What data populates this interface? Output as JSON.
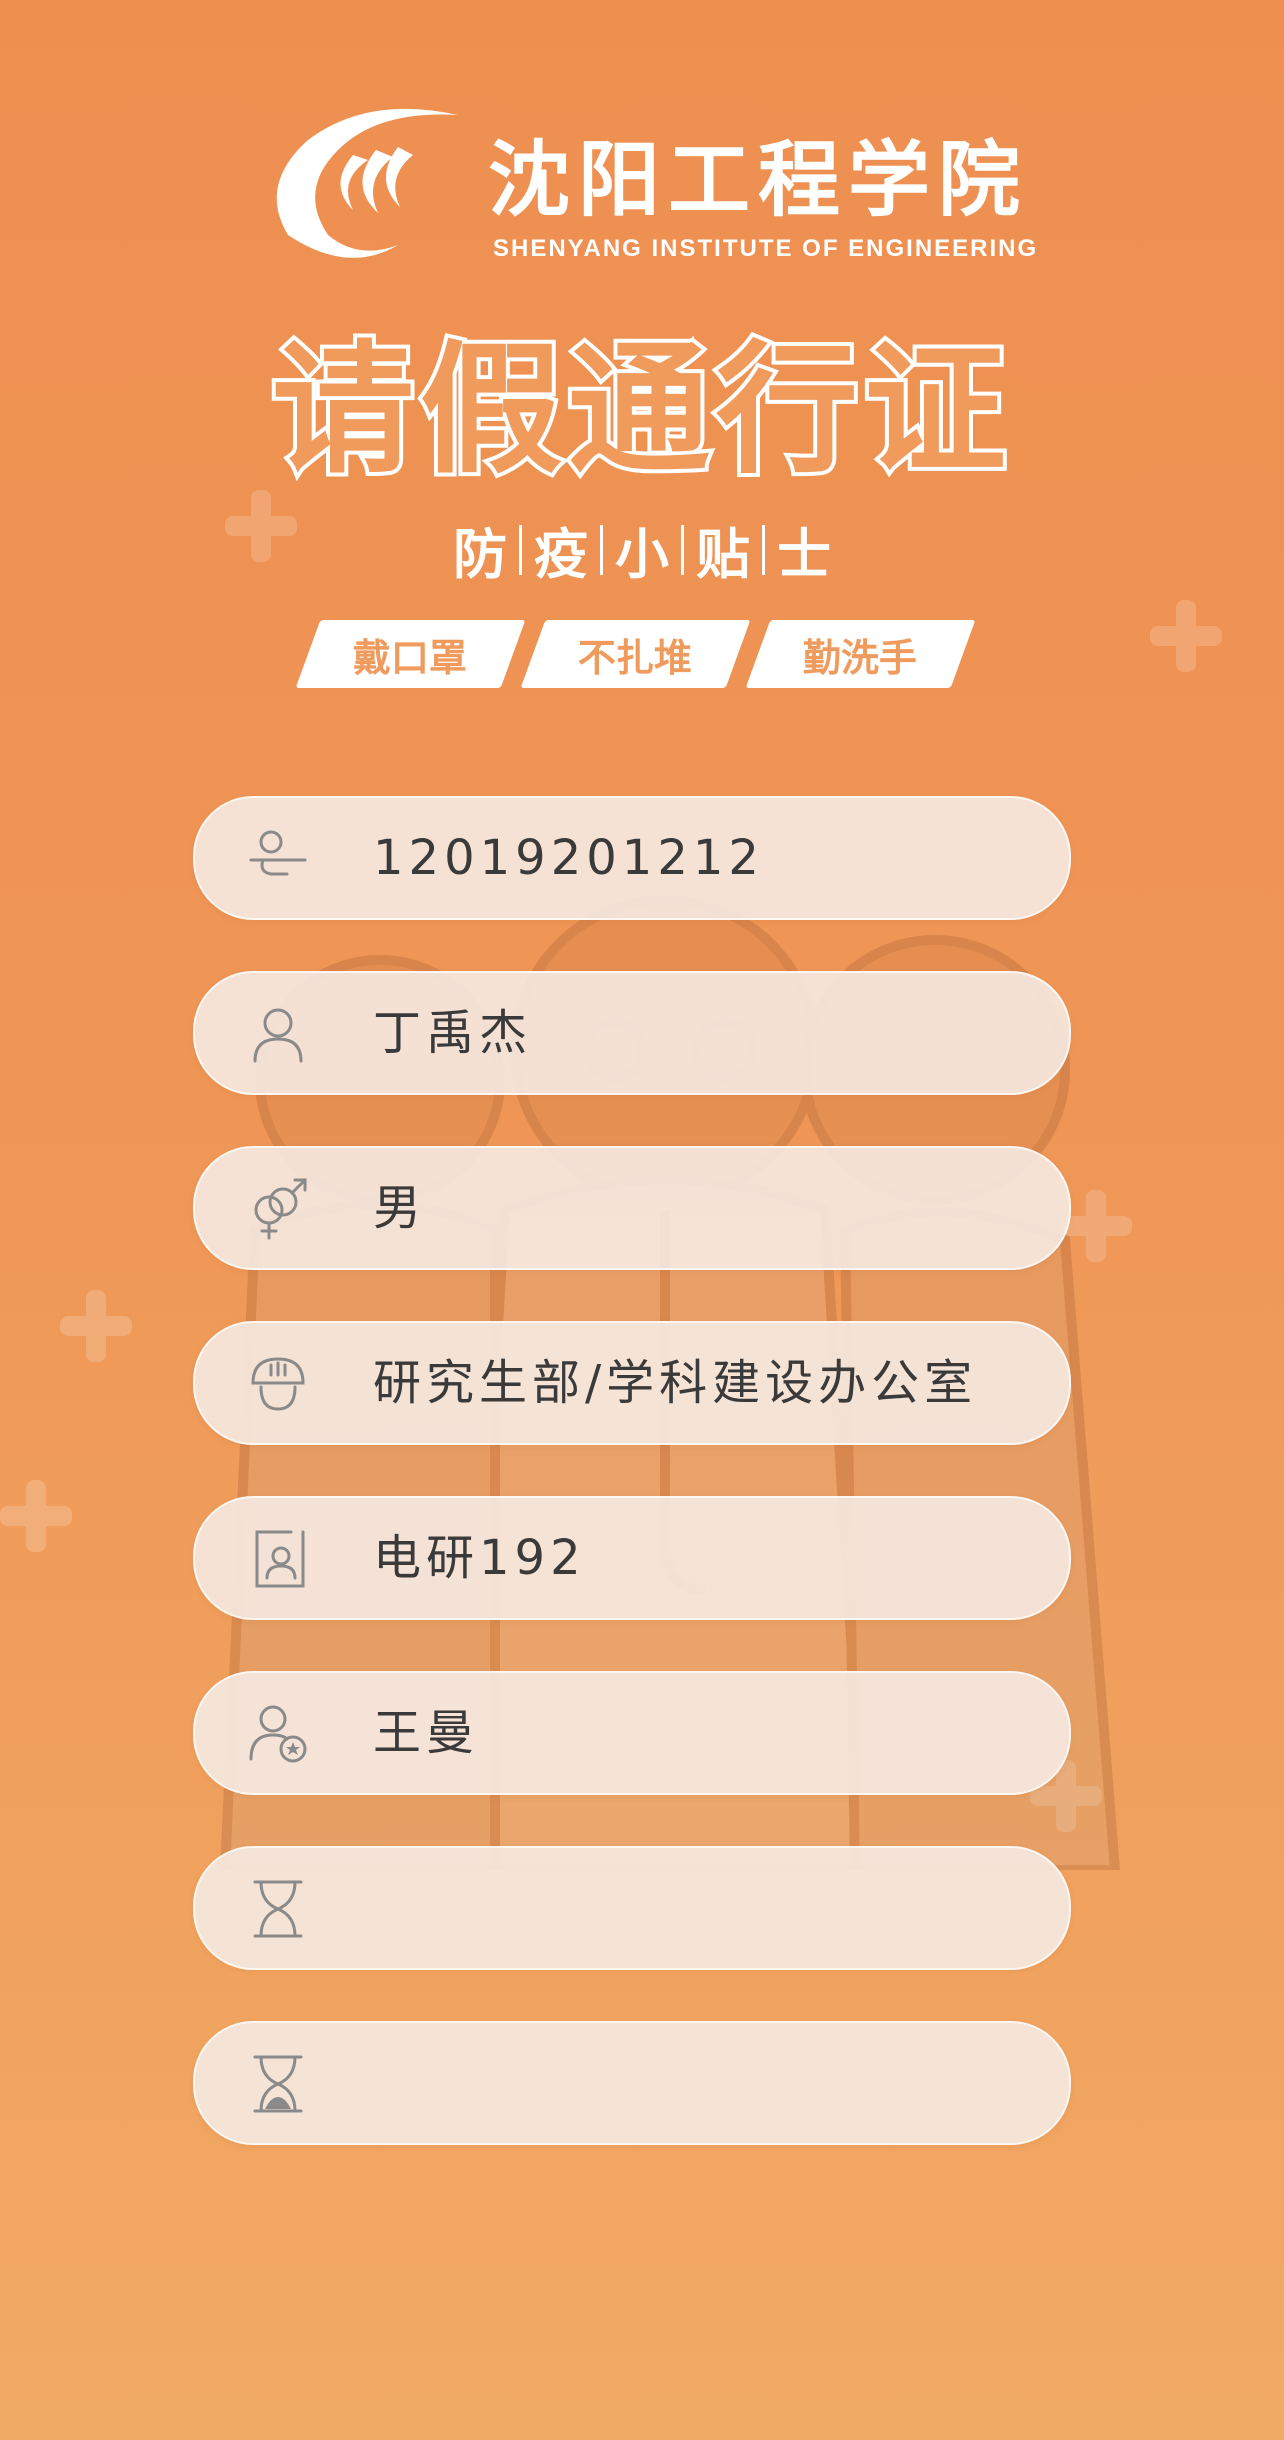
{
  "header": {
    "school_name": "沈阳工程学院",
    "school_name_en": "SHENYANG INSTITUTE OF ENGINEERING",
    "title": "请假通行证",
    "tips_chars": [
      "防",
      "疫",
      "小",
      "贴",
      "士"
    ],
    "tags": [
      "戴口罩",
      "不扎堆",
      "勤洗手"
    ]
  },
  "fields": [
    {
      "icon": "id-number-icon",
      "value": "12019201212"
    },
    {
      "icon": "person-icon",
      "value": "丁禹杰"
    },
    {
      "icon": "gender-icon",
      "value": "男"
    },
    {
      "icon": "department-icon",
      "value": "研究生部/学科建设办公室"
    },
    {
      "icon": "class-icon",
      "value": "电研192"
    },
    {
      "icon": "advisor-icon",
      "value": "王曼"
    },
    {
      "icon": "hourglass-icon",
      "value": ""
    },
    {
      "icon": "hourglass-icon",
      "value": ""
    }
  ],
  "colors": {
    "background_top": "#ee8f50",
    "background_bottom": "#f1aa64",
    "field_bg": "#f5e8e0",
    "tag_text": "#f09b5e",
    "value_text": "#3a3a3a"
  }
}
